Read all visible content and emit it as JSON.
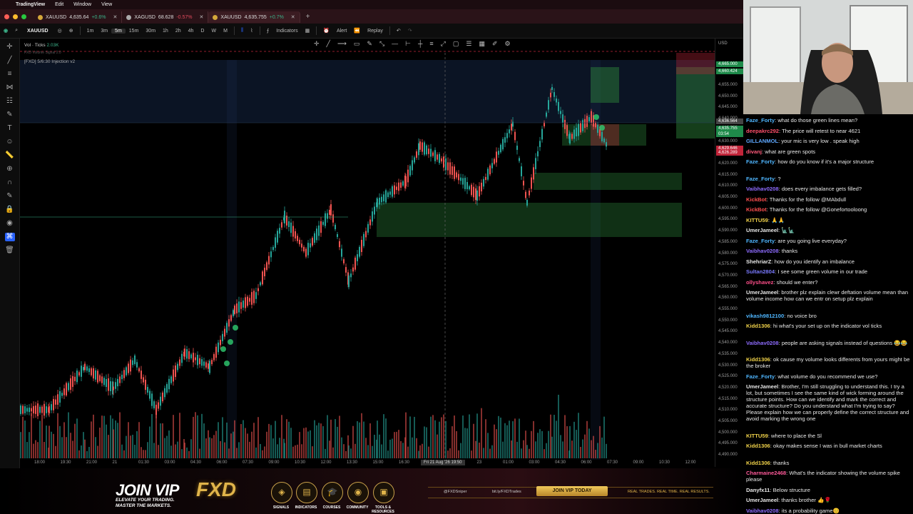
{
  "menubar": {
    "app": "TradingView",
    "items": [
      "Edit",
      "Window",
      "View"
    ]
  },
  "tabs": [
    {
      "symbol": "XAUUSD",
      "price": "4,635.64",
      "change": "+0.6%",
      "up": true
    },
    {
      "symbol": "XAGUSD",
      "price": "68.628",
      "change": "-0.57%",
      "up": false
    },
    {
      "symbol": "XAUUSD",
      "price": "4,635.755",
      "change": "+0.7%",
      "up": true
    }
  ],
  "toolbar": {
    "symbol": "XAUUSD",
    "intervals": [
      "1m",
      "3m",
      "5m",
      "15m",
      "30m",
      "1h",
      "2h",
      "4h",
      "D",
      "W",
      "M"
    ],
    "selected_interval": "5m",
    "indicators_label": "Indicators",
    "alert_label": "Alert",
    "replay_label": "Replay"
  },
  "legend": {
    "vol_label": "Vol · Ticks",
    "vol_value": "2.03K",
    "indicator": "FXD Volume Signal 2.0",
    "indicator2": "[FXD] 5/6:30 Injection v2"
  },
  "price_axis": {
    "currency": "USD",
    "ticks": [
      "4,655.000",
      "4,650.000",
      "4,645.000",
      "4,640.000",
      "4,635.000",
      "4,630.000",
      "4,625.000",
      "4,620.000",
      "4,615.000",
      "4,610.000",
      "4,605.000",
      "4,600.000",
      "4,595.000",
      "4,590.000",
      "4,585.000",
      "4,580.000",
      "4,575.000",
      "4,570.000",
      "4,565.000",
      "4,560.000",
      "4,555.000",
      "4,550.000",
      "4,545.000",
      "4,540.000",
      "4,535.000",
      "4,530.000",
      "4,525.000",
      "4,520.000",
      "4,515.000",
      "4,510.000",
      "4,505.000",
      "4,500.000",
      "4,495.000",
      "4,490.000"
    ],
    "badges": [
      {
        "text": "4,665.000",
        "color": "#1e8a4a"
      },
      {
        "text": "4,660.424",
        "color": "#1e8a4a"
      },
      {
        "text": "4,636.564",
        "color": "#444"
      },
      {
        "text": "4,635.755",
        "color": "#1e8a4a"
      },
      {
        "text": "03:54",
        "color": "#1e8a4a"
      },
      {
        "text": "4,629.646",
        "color": "#c2253a"
      },
      {
        "text": "4,626.289",
        "color": "#c2253a"
      }
    ]
  },
  "time_axis": {
    "ticks": [
      "18:00",
      "19:30",
      "21:00",
      "21",
      "01:30",
      "03:00",
      "04:30",
      "06:00",
      "07:30",
      "09:00",
      "10:30",
      "12:00",
      "13:30",
      "15:00",
      "16:30",
      "18:00",
      "19:30",
      "23",
      "01:00",
      "03:00",
      "04:30",
      "06:00",
      "07:30",
      "09:00",
      "10:30",
      "12:00"
    ],
    "cursor_label": "Fri 21 Aug '26  19:50"
  },
  "banner": {
    "headline": "JOIN VIP",
    "sub1": "ELEVATE YOUR TRADING.",
    "sub2": "MASTER THE MARKETS.",
    "brand": "FXD",
    "features": [
      "SIGNALS",
      "INDICATORS",
      "COURSES",
      "COMMUNITY",
      "TOOLS & RESOURCES"
    ],
    "handle": "@FXDSniper",
    "link": "bit.ly/FXDTrades",
    "cta": "JOIN VIP TODAY",
    "tagline": "REAL TRADES. REAL TIME. REAL RESULTS."
  },
  "chat": [
    {
      "user": "Faze_Forty",
      "color": "#4fb6ff",
      "text": "what do those green lines mean?"
    },
    {
      "user": "deepakrc292",
      "color": "#ff4f6a",
      "text": "The price will retest to near 4621"
    },
    {
      "user": "GILLANMOL",
      "color": "#5fa8ff",
      "text": "your mic is very low . speak high"
    },
    {
      "user": "divanj",
      "color": "#ff5a7a",
      "text": "what are green spots"
    },
    {
      "user": "Faze_Forty",
      "color": "#4fb6ff",
      "text": "how do you know if it's a major structure"
    },
    {
      "user": "Faze_Forty",
      "color": "#4fb6ff",
      "text": "?"
    },
    {
      "user": "Vaibhav0208",
      "color": "#8e6cff",
      "text": "does every imbalance gets filled?"
    },
    {
      "user": "KickBot",
      "color": "#ff4f4f",
      "text": "Thanks for the follow @MAbdull"
    },
    {
      "user": "KickBot",
      "color": "#ff4f4f",
      "text": "Thanks for the follow @Gonefortooloong"
    },
    {
      "user": "KITTU59",
      "color": "#f0d24a",
      "text": "🙏🙏"
    },
    {
      "user": "UmerJameel",
      "color": "#e8e8e8",
      "text": "🗽🗽"
    },
    {
      "user": "Faze_Forty",
      "color": "#4fb6ff",
      "text": "are you going live everyday?"
    },
    {
      "user": "Vaibhav0208",
      "color": "#8e6cff",
      "text": "thanks"
    },
    {
      "user": "ShehriarZ",
      "color": "#e8e8e8",
      "text": "how do you identify an imbalance"
    },
    {
      "user": "Sultan2804",
      "color": "#7a7aff",
      "text": "I see some green volume in our trade"
    },
    {
      "user": "ollyshavez",
      "color": "#ff4f8a",
      "text": "should we enter?"
    },
    {
      "user": "UmerJameel",
      "color": "#e8e8e8",
      "text": "brother plz explain clewr deftation volume mean than volume income how can we entr on setup plz explain"
    },
    {
      "user": "vikash9812100",
      "color": "#4fb6ff",
      "text": "no voice bro"
    },
    {
      "user": "Kidd1306",
      "color": "#f0d24a",
      "text": "hi what's your set up on the indicator vol ticks"
    },
    {
      "user": "Vaibhav0208",
      "color": "#8e6cff",
      "text": "people are asking signals instead of questions 😂😂"
    },
    {
      "user": "Kidd1306",
      "color": "#f0d24a",
      "text": "ok cause my volume looks differents from yours might be the broker"
    },
    {
      "user": "Faze_Forty",
      "color": "#4fb6ff",
      "text": "what volume do you recommend we use?"
    },
    {
      "user": "UmerJameel",
      "color": "#e8e8e8",
      "text": "Brother, I'm still struggling to understand this. I try a lot, but sometimes I see the same kind of wick forming around the structure points. How can we identify and mark the correct and accurate structure? Do you understand what I'm trying to say? Please explain how we can properly define the correct structure and avoid marking the wrong one"
    },
    {
      "user": "KITTU59",
      "color": "#f0d24a",
      "text": "where to place the Sl"
    },
    {
      "user": "Kidd1306",
      "color": "#f0d24a",
      "text": "okay makes sense I was in bull market charts"
    },
    {
      "user": "Kidd1306",
      "color": "#f0d24a",
      "text": "thanks"
    },
    {
      "user": "Charmaine2468",
      "color": "#ff5a9a",
      "text": "What's the indicator showing the volume spike please"
    },
    {
      "user": "Danyfx11",
      "color": "#e8e8e8",
      "text": "Below structure"
    },
    {
      "user": "UmerJameel",
      "color": "#e8e8e8",
      "text": "thanks brother 👍🌹"
    },
    {
      "user": "Vaibhav0208",
      "color": "#8e6cff",
      "text": "its a probability game😊"
    }
  ],
  "colors": {
    "up": "#26a69a",
    "down": "#ef5350",
    "zone": "#1e6b2e",
    "chart_bg": "#000000"
  }
}
